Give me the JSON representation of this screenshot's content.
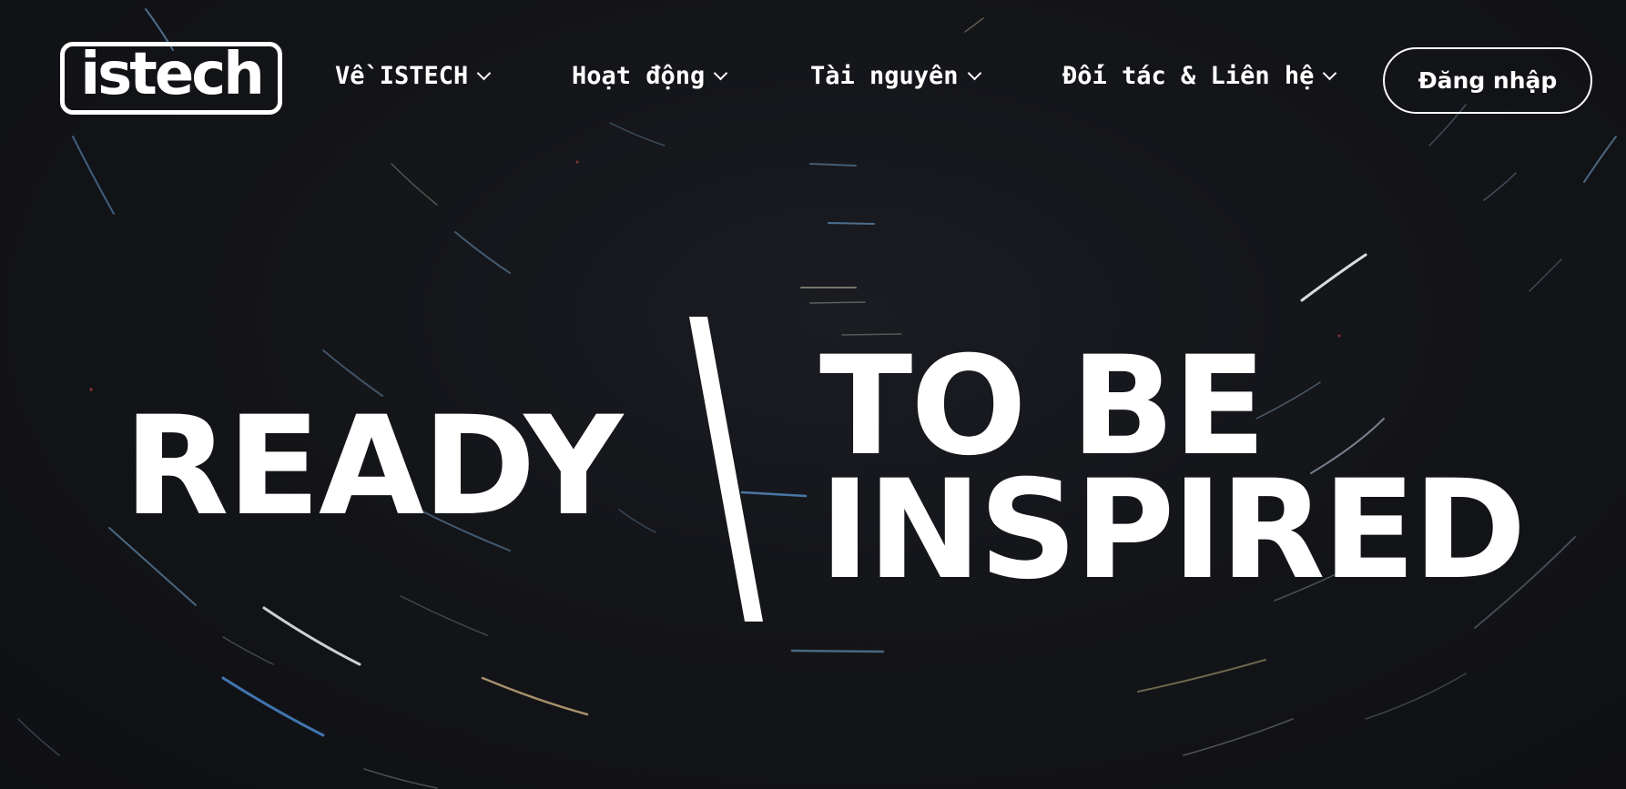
{
  "brand": {
    "logo_text": "istech"
  },
  "nav": {
    "items": [
      {
        "label": "Về ISTECH"
      },
      {
        "label": "Hoạt động"
      },
      {
        "label": "Tài nguyên"
      },
      {
        "label": "Đối tác & Liên hệ"
      }
    ],
    "login_label": "Đăng nhập"
  },
  "hero": {
    "word_left": "READY",
    "line1": "TO BE",
    "line2": "INSPIRED"
  },
  "colors": {
    "background": "#121317",
    "text": "#ffffff",
    "trail_white": "#e9edf2",
    "trail_blue": "#4e8fd6",
    "trail_gold": "#d9b98a"
  },
  "icons": {
    "dropdown": "chevron-down-icon"
  }
}
